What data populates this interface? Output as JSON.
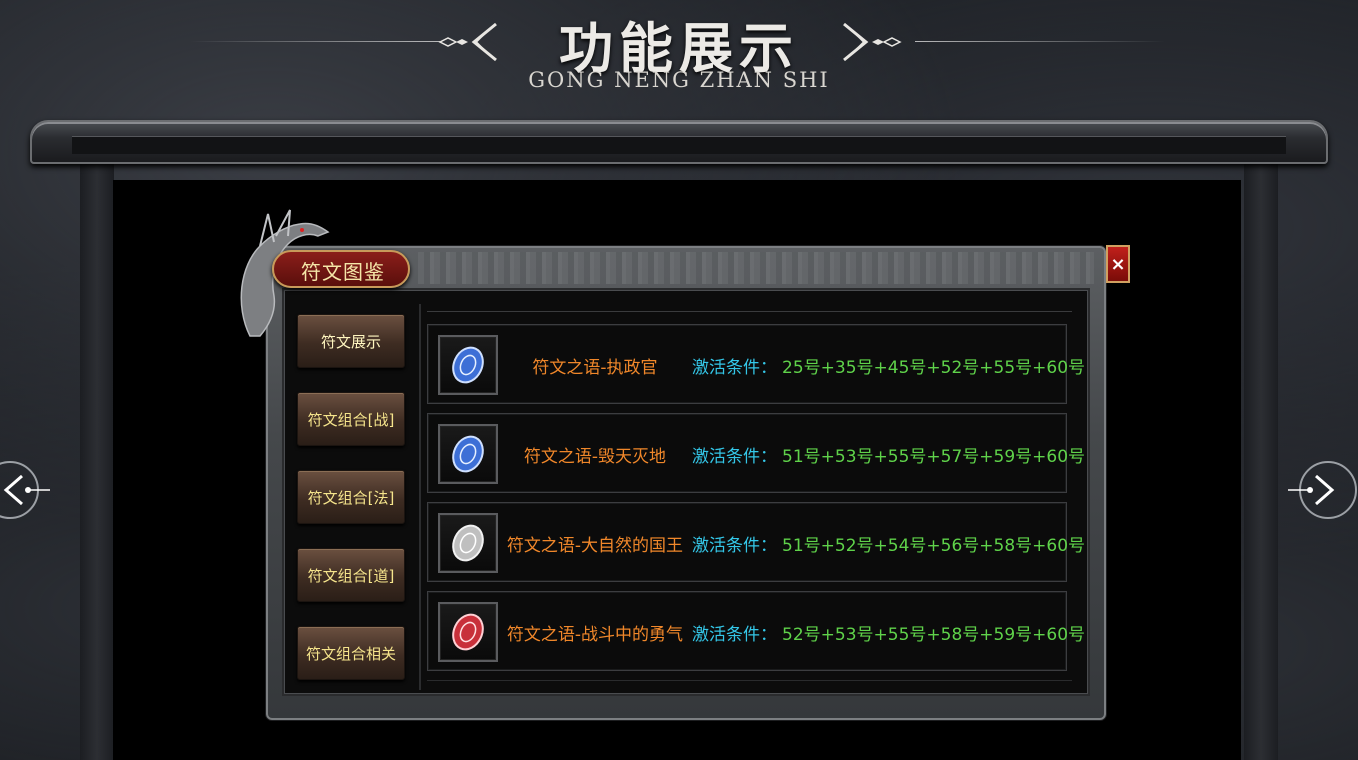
{
  "header": {
    "title": "功能展示",
    "subtitle": "GONG NENG ZHAN SHI"
  },
  "panel": {
    "title": "符文图鉴",
    "close_label": "×"
  },
  "tabs": [
    {
      "label": "符文展示",
      "active": true
    },
    {
      "label": "符文组合[战]",
      "active": false
    },
    {
      "label": "符文组合[法]",
      "active": false
    },
    {
      "label": "符文组合[道]",
      "active": false
    },
    {
      "label": "符文组合相关",
      "active": false
    }
  ],
  "runewords": [
    {
      "name": "符文之语-执政官",
      "condition_label": "激活条件：",
      "condition": "25号+35号+45号+52号+55号+60号",
      "rune_color": "#3d6fd6",
      "icon": "blue-rune-icon"
    },
    {
      "name": "符文之语-毁天灭地",
      "condition_label": "激活条件：",
      "condition": "51号+53号+55号+57号+59号+60号",
      "rune_color": "#3d6fd6",
      "icon": "blue-rune-icon"
    },
    {
      "name": "符文之语-大自然的国王",
      "condition_label": "激活条件：",
      "condition": "51号+52号+54号+56号+58号+60号",
      "rune_color": "#bfbfbf",
      "icon": "silver-rune-icon"
    },
    {
      "name": "符文之语-战斗中的勇气",
      "condition_label": "激活条件：",
      "condition": "52号+53号+55号+58号+59号+60号",
      "rune_color": "#c8303a",
      "icon": "red-rune-icon"
    }
  ],
  "colors": {
    "name_orange": "#f0872a",
    "label_cyan": "#34c7e8",
    "condition_green": "#5fd24a",
    "tab_text": "#f6e58c"
  }
}
